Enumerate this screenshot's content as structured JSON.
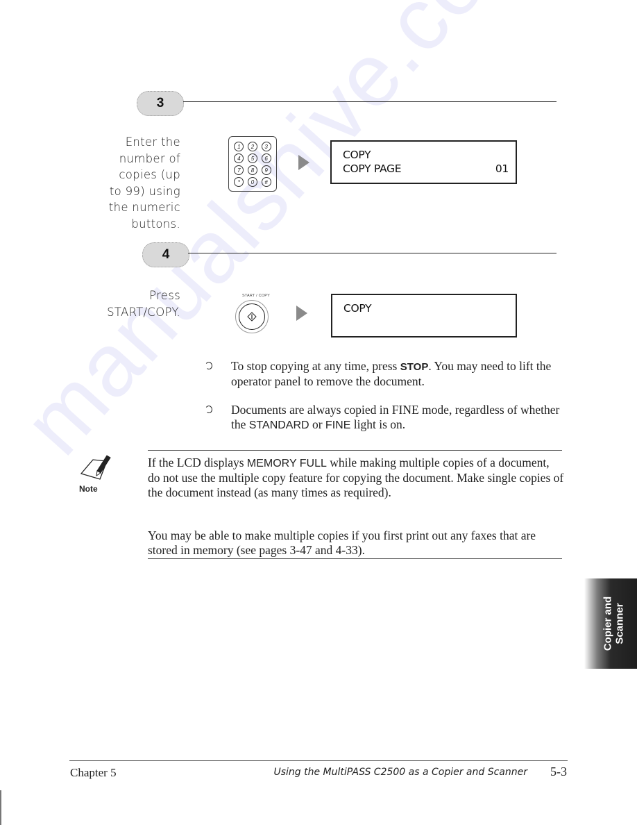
{
  "steps": [
    {
      "number": "3",
      "instruction_lines": [
        "Enter the",
        "number of",
        "copies (up",
        "to 99) using",
        "the numeric",
        "buttons."
      ],
      "keypad_keys": [
        "1",
        "2",
        "3",
        "4",
        "5",
        "6",
        "7",
        "8",
        "9",
        "*",
        "0",
        "#"
      ],
      "lcd": {
        "line1": "COPY",
        "line2": "COPY PAGE",
        "line2_value": "01"
      }
    },
    {
      "number": "4",
      "instruction_lines": [
        "Press",
        "START/COPY."
      ],
      "button_label": "START / COPY",
      "button_icon": "start-diamond-icon",
      "lcd": {
        "line1": "COPY",
        "line2": ""
      }
    }
  ],
  "bullets": [
    {
      "parts": [
        {
          "text": "To stop copying at any time, press ",
          "style": "serif"
        },
        {
          "text": "STOP",
          "style": "sans-bold"
        },
        {
          "text": ". You may need to lift the operator panel to remove the document.",
          "style": "serif"
        }
      ]
    },
    {
      "parts": [
        {
          "text": "Documents are always copied in FINE mode, regardless of whether the ",
          "style": "serif"
        },
        {
          "text": "STANDARD",
          "style": "sans"
        },
        {
          "text": " or ",
          "style": "serif"
        },
        {
          "text": "FINE",
          "style": "sans"
        },
        {
          "text": " light is on.",
          "style": "serif"
        }
      ]
    }
  ],
  "note": {
    "label": "Note",
    "paragraph1": {
      "before": "If the LCD displays ",
      "lcd_term": "MEMORY FULL",
      "after": " while making multiple copies of a document, do not use the multiple copy feature for copying the document. Make single copies of the document instead (as many times as required)."
    },
    "paragraph2": "You may be able to make multiple copies if you first print out any faxes that are stored in memory (see pages 3-47 and 4-33)."
  },
  "side_tab": {
    "line1": "Copier and",
    "line2": "Scanner"
  },
  "footer": {
    "chapter": "Chapter 5",
    "title": "Using the MultiPASS C2500 as a Copier and Scanner",
    "page": "5-3"
  },
  "watermark": "manualshive.com"
}
